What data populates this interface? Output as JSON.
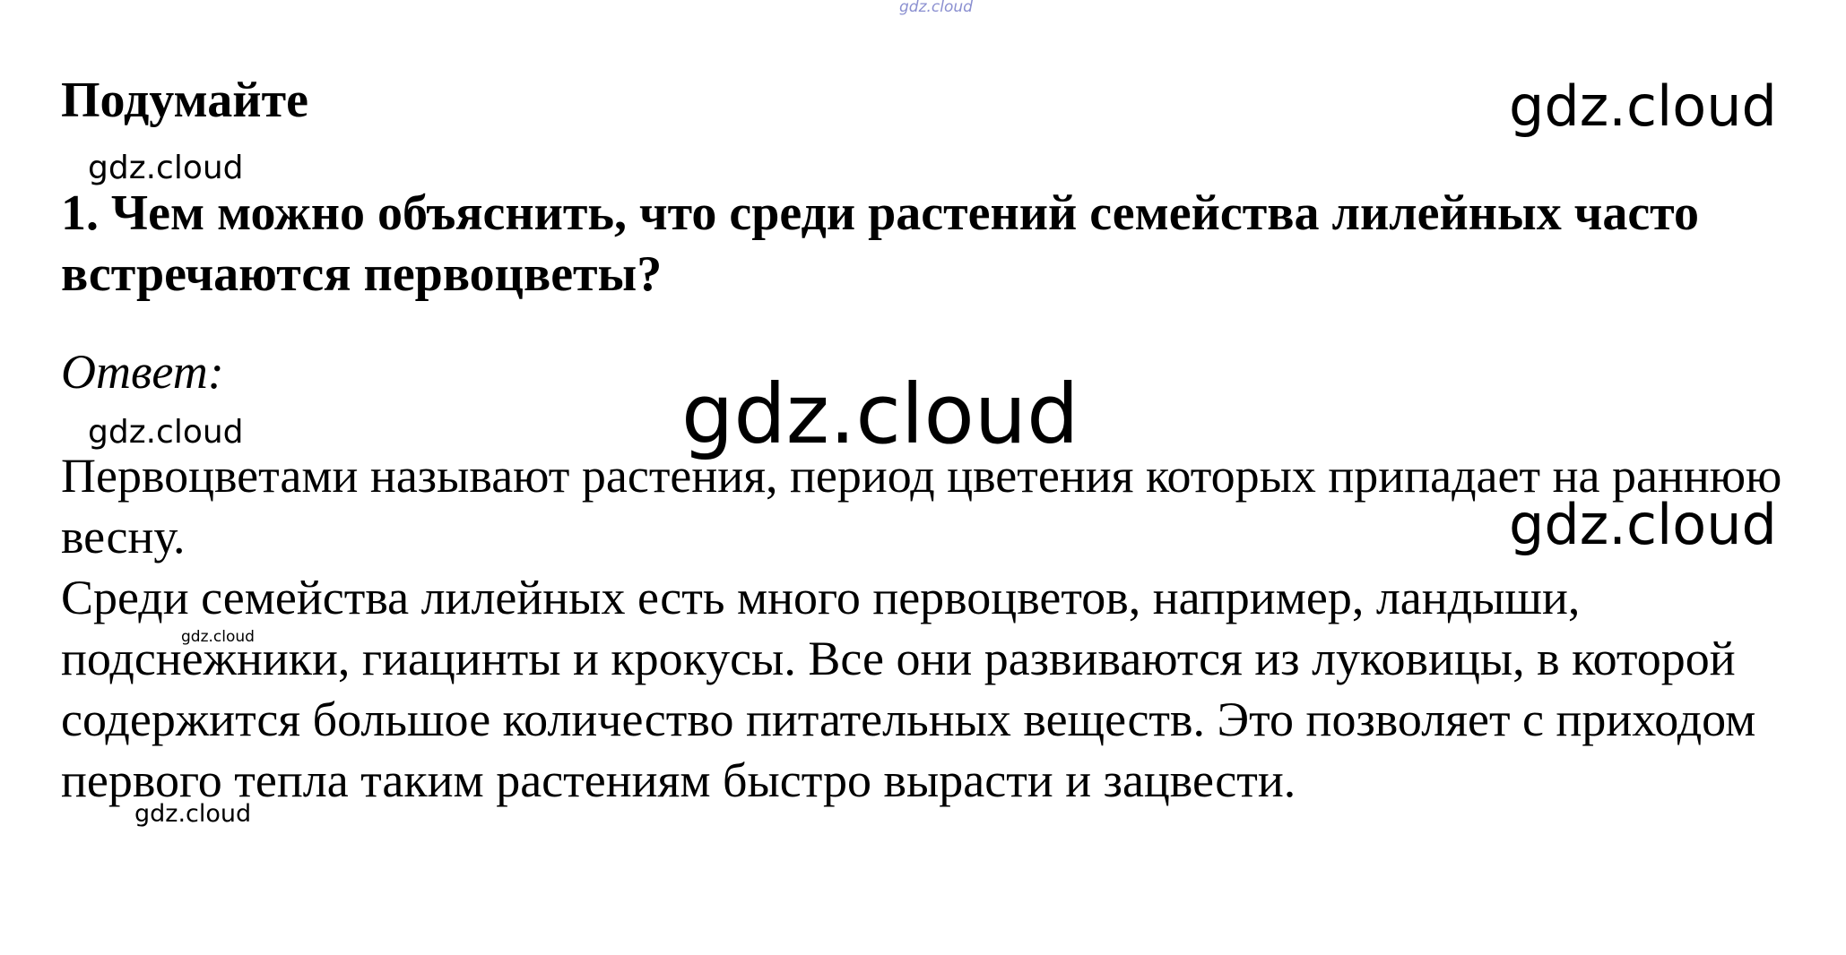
{
  "heading": "Подумайте",
  "question": "1. Чем можно объяснить, что среди растений семейства лилейных часто встречаются первоцветы?",
  "answer_label": "Ответ:",
  "answer_paragraphs": [
    "Первоцветами называют растения, период цветения которых припадает на раннюю весну.",
    "Среди семейства лилейных есть много первоцветов, например, ландыши, подснежники, гиацинты и крокусы. Все они развиваются из луковицы, в которой содержится большое количество питательных веществ. Это позволяет с приходом первого тепла таким растениям быстро вырасти и зацвести."
  ],
  "watermarks": {
    "top": "gdz.cloud",
    "right_1": "gdz.cloud",
    "small_1": "gdz.cloud",
    "center": "gdz.cloud",
    "small_2": "gdz.cloud",
    "right_2": "gdz.cloud",
    "tiny": "gdz.cloud",
    "small_3": "gdz.cloud"
  }
}
